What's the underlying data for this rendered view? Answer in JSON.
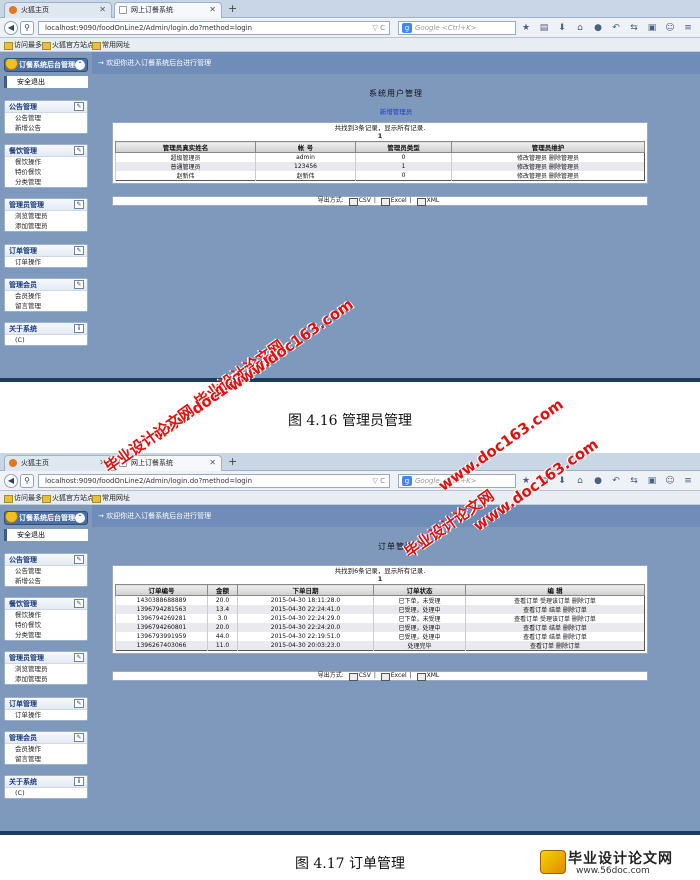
{
  "browser": {
    "tab_home": "火狐主页",
    "tab_app": "网上订餐系统",
    "new_tab": "+",
    "url1": "localhost:9090/foodOnLine2/Admin/login.do?method=login",
    "url2": "localhost:9090/foodOnLine2/Admin/login.do?method=login",
    "search_placeholder": "Google <Ctrl+K>",
    "bookmarks": [
      "访问最多",
      "火狐官方站点",
      "常用网址"
    ]
  },
  "app": {
    "logo": "订餐系统后台管理",
    "welcome": "→ 欢迎你进入订餐系统后台进行管理",
    "logout": "安全退出",
    "menus": [
      {
        "title": "公告管理",
        "items": [
          "公告管理",
          "新增公告"
        ]
      },
      {
        "title": "餐饮管理",
        "items": [
          "餐饮操作",
          "特价餐饮",
          "分类管理"
        ]
      },
      {
        "title": "管理员管理",
        "items": [
          "浏览管理员",
          "添加管理员"
        ]
      },
      {
        "title": "订单管理",
        "items": [
          "订单操作"
        ]
      },
      {
        "title": "管理会员",
        "items": [
          "会员操作",
          "留言管理"
        ]
      },
      {
        "title": "关于系统",
        "items": [
          "(C)"
        ]
      }
    ]
  },
  "shot1": {
    "page_title": "系统用户管理",
    "add_link": "新增管理员",
    "found_text": "共找到3条记录，显示所有记录.",
    "page_number": "1",
    "headers": [
      "管理员真实姓名",
      "帐 号",
      "管理员类型",
      "管理员维护"
    ],
    "rows": [
      [
        "超级管理员",
        "admin",
        "0",
        "修改管理员 删除管理员"
      ],
      [
        "普通管理员",
        "123456",
        "1",
        "修改管理员 删除管理员"
      ],
      [
        "赵新伟",
        "赵新伟",
        "0",
        "修改管理员 删除管理员"
      ]
    ],
    "export_label": "导出方式:",
    "export_options": [
      "CSV",
      "Excel",
      "XML"
    ]
  },
  "shot2": {
    "page_title": "订单管理",
    "found_text": "共找到6条记录，显示所有记录.",
    "page_number": "1",
    "headers": [
      "订单编号",
      "金额",
      "下单日期",
      "订单状态",
      "编 辑"
    ],
    "rows": [
      [
        "1430388688889",
        "20.0",
        "2015-04-30 18:11:28.0",
        "已下单，未受理",
        "查看订单 受理该订单 删除订单"
      ],
      [
        "1396794281563",
        "13.4",
        "2015-04-30 22:24:41.0",
        "已受理，处理中",
        "查看订单 结单 删除订单"
      ],
      [
        "1396794269281",
        "3.0",
        "2015-04-30 22:24:29.0",
        "已下单，未受理",
        "查看订单 受理该订单 删除订单"
      ],
      [
        "1396794260801",
        "20.0",
        "2015-04-30 22:24:20.0",
        "已受理，处理中",
        "查看订单 结单 删除订单"
      ],
      [
        "1396793991959",
        "44.0",
        "2015-04-30 22:19:51.0",
        "已受理，处理中",
        "查看订单 结单 删除订单"
      ],
      [
        "1396267403066",
        "11.0",
        "2015-04-30 20:03:23.0",
        "处理完毕",
        "查看订单 删除订单"
      ]
    ],
    "export_label": "导出方式:",
    "export_options": [
      "CSV",
      "Excel",
      "XML"
    ]
  },
  "captions": {
    "fig1": "图 4.16 管理员管理",
    "fig2": "图 4.17 订单管理"
  },
  "watermarks": {
    "cn": "毕业设计论文网",
    "url": "www.doc163.com",
    "corner_title": "毕业设计论文网",
    "corner_url": "www.56doc.com"
  },
  "colors": {
    "page_bg": "#7f99bd",
    "watermark": "#e01010",
    "link": "#1a3ad0"
  }
}
